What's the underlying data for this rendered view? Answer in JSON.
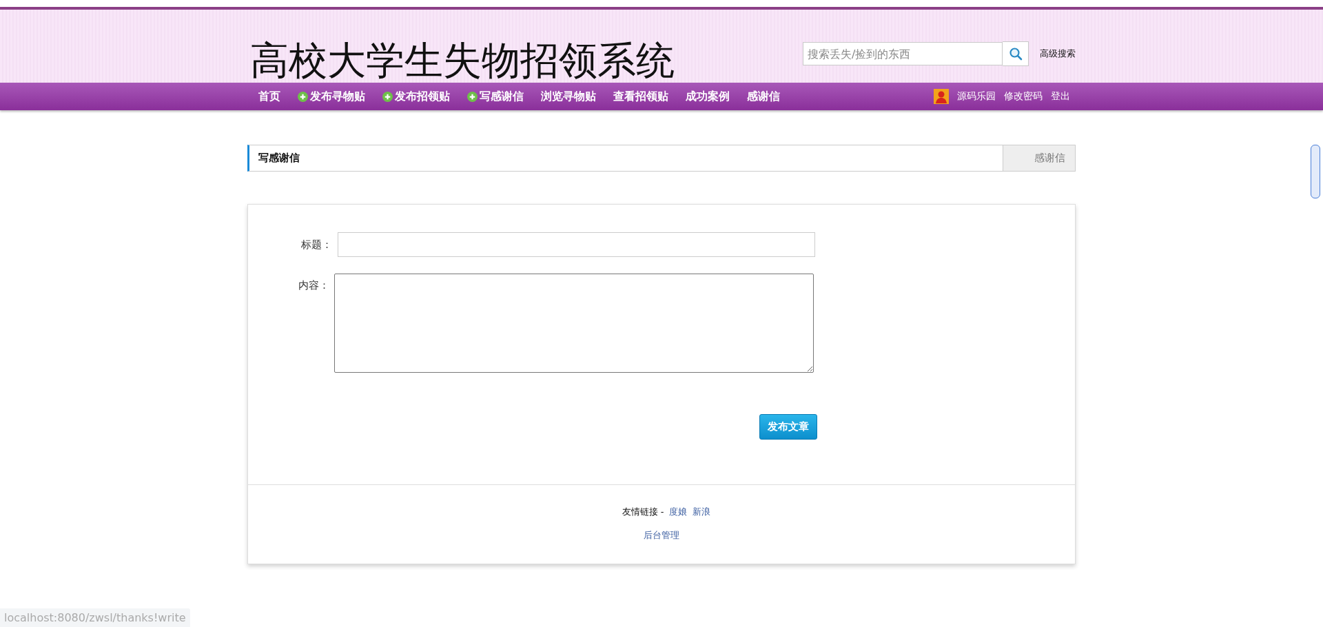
{
  "header": {
    "site_title": "高校大学生失物招领系统",
    "search": {
      "placeholder": "搜索丢失/捡到的东西"
    },
    "advanced_search": "高级搜索"
  },
  "nav": {
    "items": [
      {
        "label": "首页",
        "kind": "plain"
      },
      {
        "label": "发布寻物贴",
        "kind": "add"
      },
      {
        "label": "发布招领贴",
        "kind": "add"
      },
      {
        "label": "写感谢信",
        "kind": "add"
      },
      {
        "label": "浏览寻物贴",
        "kind": "plain"
      },
      {
        "label": "查看招领贴",
        "kind": "plain"
      },
      {
        "label": "成功案例",
        "kind": "plain"
      },
      {
        "label": "感谢信",
        "kind": "plain"
      }
    ],
    "user": {
      "name": "源码乐园",
      "links": [
        "修改密码",
        "登出"
      ]
    }
  },
  "section": {
    "title": "写感谢信",
    "tab": "感谢信"
  },
  "form": {
    "fields": [
      {
        "label": "标题：",
        "kind": "input"
      },
      {
        "label": "内容：",
        "kind": "textarea"
      }
    ],
    "submit": "发布文章"
  },
  "footer": {
    "links_label": "友情链接 -",
    "links": [
      "度娘",
      "新浪"
    ],
    "admin": "后台管理"
  },
  "status_bar": "localhost:8080/zwsl/thanks!write"
}
